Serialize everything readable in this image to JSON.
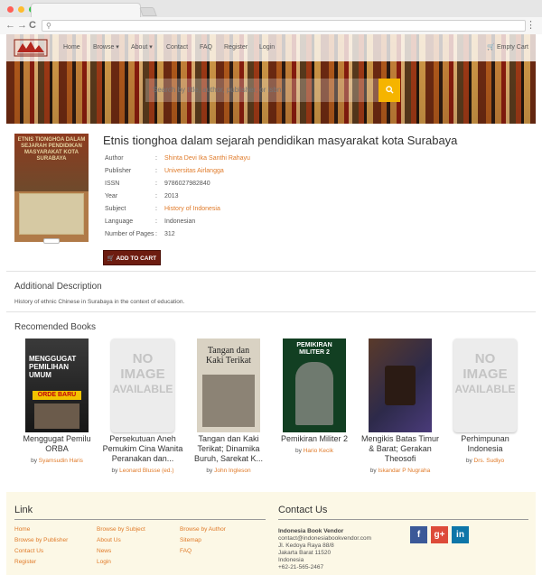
{
  "browser": {
    "back_glyph": "←",
    "forward_glyph": "→",
    "reload_glyph": "C",
    "search_glyph": "⚲",
    "menu_glyph": "⋮",
    "dot_colors": [
      "#ff5f57",
      "#febc2e",
      "#28c840"
    ]
  },
  "nav": {
    "items": [
      "Home",
      "Browse ▾",
      "About ▾",
      "Contact",
      "FAQ",
      "Register",
      "Login"
    ],
    "cart": "🛒 Empty Cart"
  },
  "search": {
    "placeholder": "Search by title, author, publisher, or isbn",
    "button_icon": "search-icon"
  },
  "book": {
    "title": "Etnis tionghoa dalam sejarah pendidikan masyarakat kota Surabaya",
    "cover_text": "ETNIS TIONGHOA DALAM SEJARAH PENDIDIKAN MASYARAKAT KOTA SURABAYA",
    "details": [
      {
        "label": "Author",
        "value": "Shinta Devi Ika Santhi Rahayu",
        "link": true
      },
      {
        "label": "Publisher",
        "value": "Universitas Airlangga",
        "link": true
      },
      {
        "label": "ISSN",
        "value": "9786027982840",
        "link": false
      },
      {
        "label": "Year",
        "value": "2013",
        "link": false
      },
      {
        "label": "Subject",
        "value": "History of Indonesia",
        "link": true
      },
      {
        "label": "Language",
        "value": "Indonesian",
        "link": false
      },
      {
        "label": "Number of Pages",
        "value": "312",
        "link": false
      }
    ],
    "separator": ":",
    "add_to_cart": "🛒 ADD TO CART"
  },
  "description": {
    "heading": "Additional Description",
    "text": "History of ethnic Chinese in Surabaya in the context of education."
  },
  "recommended": {
    "heading": "Recomended Books",
    "by_label": "by",
    "books": [
      {
        "title": "Menggugat Pemilu ORBA",
        "author": "Syamsudin Haris",
        "cover": "menggugat"
      },
      {
        "title": "Persekutuan Aneh Pemukim Cina Wanita Peranakan dan...",
        "author": "Leonard Blusse (ed.)",
        "cover": "none"
      },
      {
        "title": "Tangan dan Kaki Terikat; Dinamika Buruh, Sarekat K...",
        "author": "John Ingleson",
        "cover": "tangan"
      },
      {
        "title": "Pemikiran Militer 2",
        "author": "Hario Kecik",
        "cover": "pemikiran"
      },
      {
        "title": "Mengikis Batas Timur & Barat; Gerakan Theosofi",
        "author": "Iskandar P Nugraha",
        "cover": "mengikis"
      },
      {
        "title": "Perhimpunan Indonesia",
        "author": "Drs. Sudiyo",
        "cover": "none"
      }
    ],
    "noimage_text": [
      "NO",
      "IMAGE",
      "AVAILABLE"
    ]
  },
  "covers": {
    "menggugat": {
      "top": "MENGGUGAT PEMILIHAN UMUM",
      "badge": "ORDE BARU"
    },
    "tangan": {
      "top": "Tangan dan Kaki Terikat"
    },
    "pemikiran": {
      "top": "PEMIKIRAN MILITER 2"
    }
  },
  "footer": {
    "link_heading": "Link",
    "links_col1": [
      "Home",
      "Browse by Publisher",
      "Contact Us",
      "Register"
    ],
    "links_col2": [
      "Browse by Subject",
      "About Us",
      "News",
      "Login"
    ],
    "links_col3": [
      "Browse by Author",
      "Sitemap",
      "FAQ"
    ],
    "contact_heading": "Contact Us",
    "contact_lines": [
      "Indonesia Book Vendor",
      "contact@indonesiabookvendor.com",
      "Jl. Kedoya Raya 88/8",
      "Jakarta Barat 11520",
      "Indonesia",
      "+62-21-565-2467"
    ],
    "social": [
      "f",
      "g+",
      "in"
    ],
    "social_colors": [
      "#3b5998",
      "#dd4b39",
      "#0e76a8"
    ]
  },
  "colors": {
    "accent": "#e07b2a",
    "cart_button": "#6d1c10",
    "search_button": "#f5b400",
    "footer_bg": "#fcf8e6"
  }
}
